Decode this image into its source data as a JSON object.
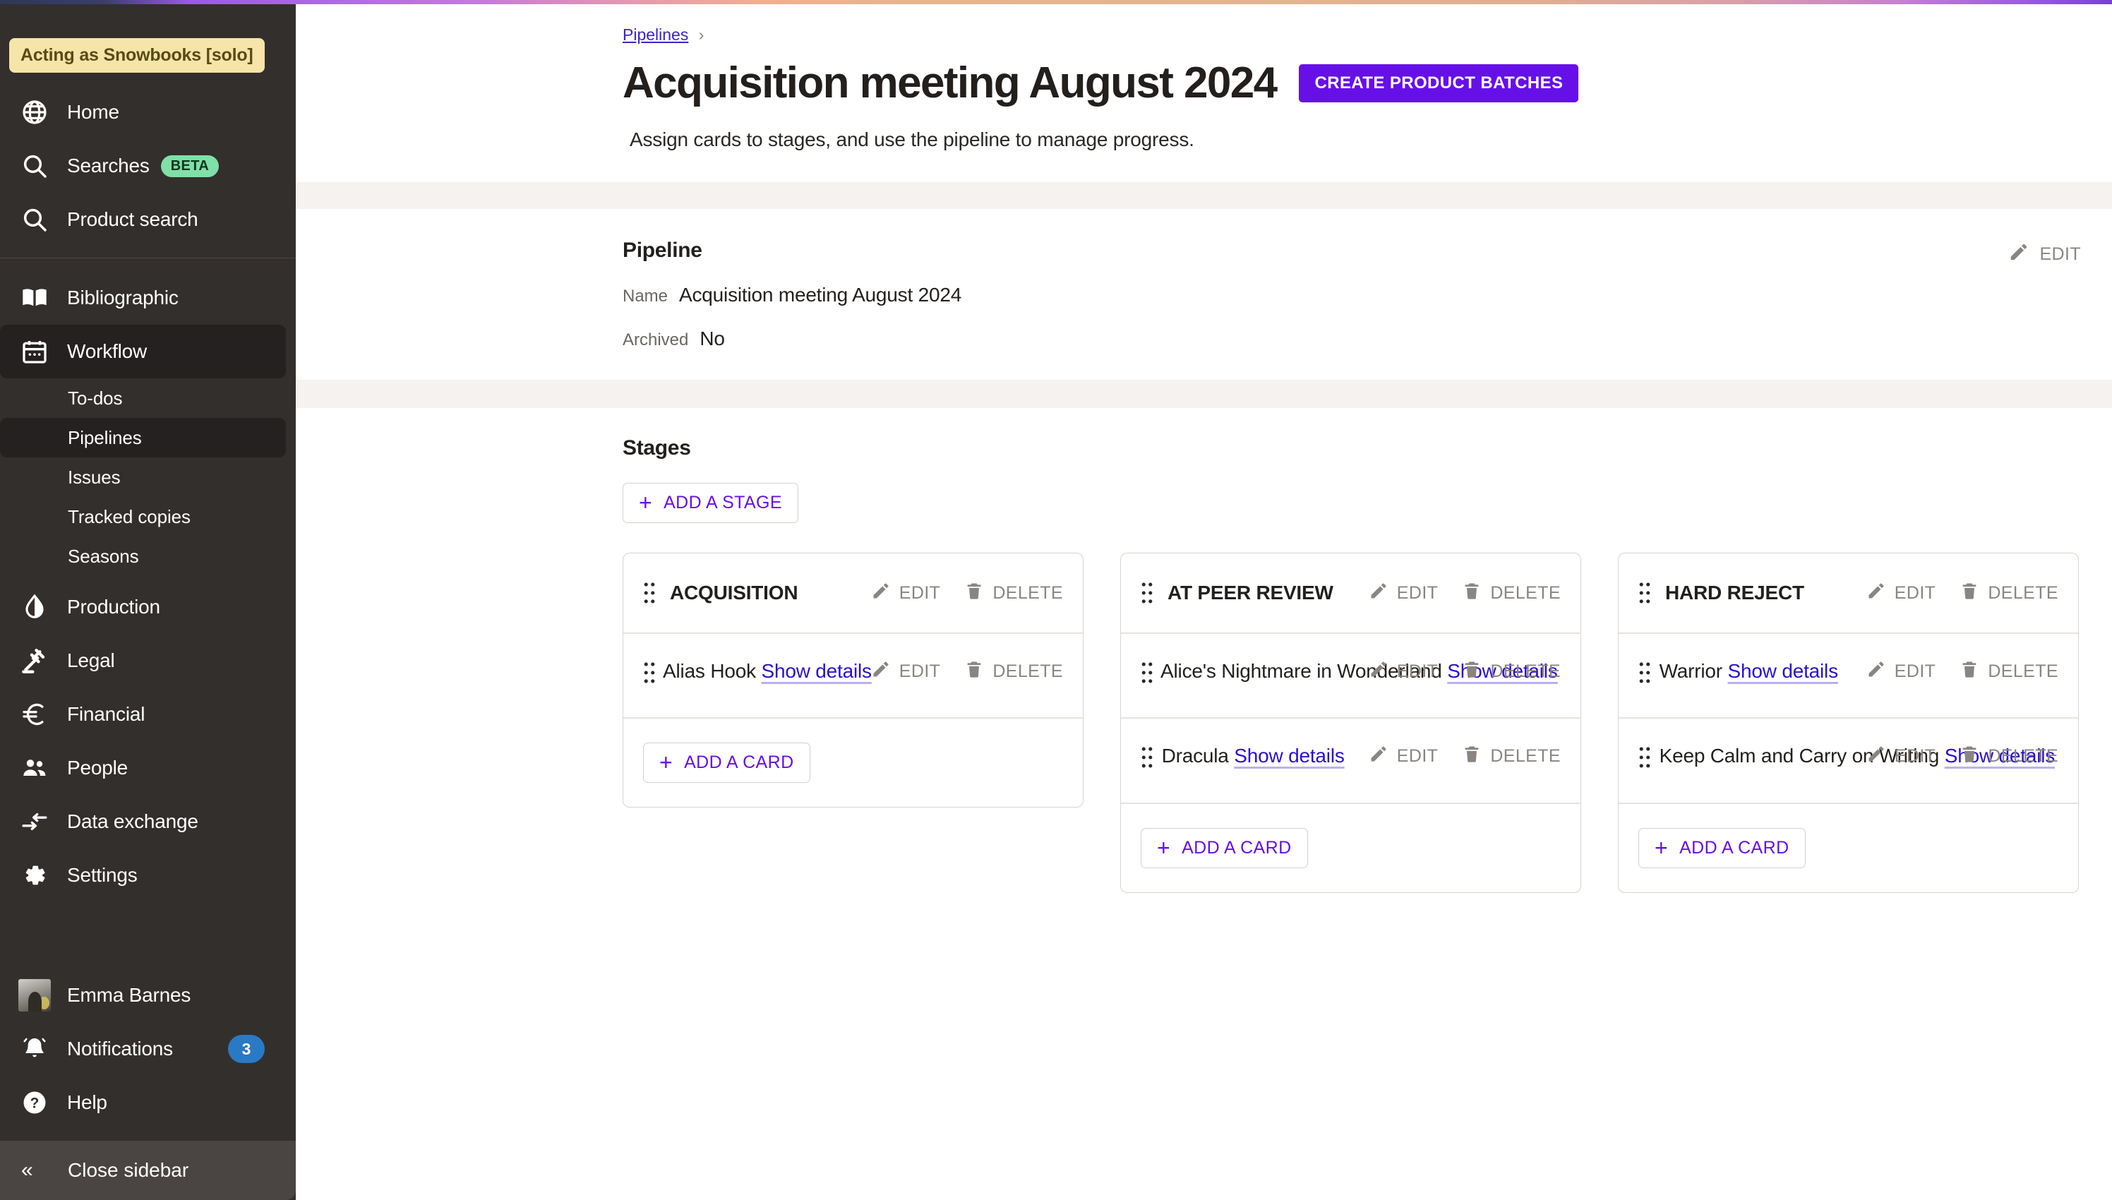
{
  "sidebar": {
    "acting_as": "Acting as Snowbooks [solo]",
    "primary_items": [
      {
        "label": "Home",
        "icon": "globe-icon"
      },
      {
        "label": "Searches",
        "icon": "search-icon",
        "badge": "BETA"
      },
      {
        "label": "Product search",
        "icon": "search-icon"
      }
    ],
    "secondary_items": [
      {
        "label": "Bibliographic",
        "icon": "book-icon"
      },
      {
        "label": "Workflow",
        "icon": "calendar-icon",
        "active": true
      },
      {
        "label": "Production",
        "icon": "droplet-icon"
      },
      {
        "label": "Legal",
        "icon": "gavel-icon"
      },
      {
        "label": "Financial",
        "icon": "euro-icon"
      },
      {
        "label": "People",
        "icon": "people-icon"
      },
      {
        "label": "Data exchange",
        "icon": "data-exchange-icon"
      },
      {
        "label": "Settings",
        "icon": "gear-icon"
      }
    ],
    "workflow_subitems": [
      {
        "label": "To-dos"
      },
      {
        "label": "Pipelines",
        "active": true
      },
      {
        "label": "Issues"
      },
      {
        "label": "Tracked copies"
      },
      {
        "label": "Seasons"
      }
    ],
    "user_name": "Emma Barnes",
    "notifications_label": "Notifications",
    "notifications_count": "3",
    "help_label": "Help",
    "close_sidebar_label": "Close sidebar",
    "close_sidebar_chevron": "«"
  },
  "breadcrumb": {
    "parent": "Pipelines",
    "separator": "›"
  },
  "header": {
    "title": "Acquisition meeting August 2024",
    "primary_button": "CREATE PRODUCT BATCHES",
    "subtitle": "Assign cards to stages, and use the pipeline to manage progress."
  },
  "pipeline_section": {
    "heading": "Pipeline",
    "edit_label": "EDIT",
    "fields": [
      {
        "label": "Name",
        "value": "Acquisition meeting August 2024"
      },
      {
        "label": "Archived",
        "value": "No"
      }
    ]
  },
  "stages_section": {
    "heading": "Stages",
    "add_stage_label": "ADD A STAGE",
    "add_card_label": "ADD A CARD",
    "edit_label": "EDIT",
    "delete_label": "DELETE",
    "show_details_label": "Show details",
    "stages": [
      {
        "name": "ACQUISITION",
        "cards": [
          {
            "title": "Alias Hook"
          }
        ]
      },
      {
        "name": "AT PEER REVIEW",
        "cards": [
          {
            "title": "Alice's Nightmare in Wonderland"
          },
          {
            "title": "Dracula"
          }
        ]
      },
      {
        "name": "HARD REJECT",
        "cards": [
          {
            "title": "Warrior"
          },
          {
            "title": "Keep Calm and Carry on Writing"
          }
        ]
      }
    ]
  },
  "colors": {
    "sidebar_bg": "#332f2d",
    "accent_purple": "#6610e8",
    "link_blue": "#2a0fd0",
    "badge_green": "#7fe0a8",
    "badge_blue": "#2a79c4",
    "acting_yellow": "#f7e4a8",
    "band_beige": "#f5f2ef"
  }
}
